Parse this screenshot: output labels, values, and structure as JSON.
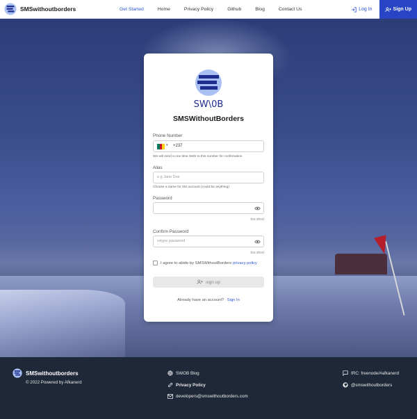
{
  "nav": {
    "brand": "SMSwithoutborders",
    "links": [
      "Get Started",
      "Home",
      "Privacy Policy",
      "Github",
      "Blog",
      "Contact Us"
    ],
    "active_index": 0,
    "login": "Log In",
    "signup": "Sign Up"
  },
  "card": {
    "logo_text": "SW\\0B",
    "title": "SMSWithoutBorders",
    "phone": {
      "label": "Phone Number",
      "dial_code": "+237",
      "helper": "We will send a one time SMS to this number for confirmation"
    },
    "alias": {
      "label": "Alias",
      "placeholder": "e.g Jane Doe",
      "helper": "Choose a name for this account (could be anything)"
    },
    "password": {
      "label": "Password",
      "placeholder": "",
      "strength": "too short"
    },
    "confirm_password": {
      "label": "Confirm Password",
      "placeholder": "retype password",
      "strength": "too short"
    },
    "terms": {
      "text": "I agree to abide by SMSWithoutBorders",
      "link": "privacy policy",
      "checked": false
    },
    "submit": "sign up",
    "login_prompt": "Already have an account?",
    "login_link": "Sign In"
  },
  "footer": {
    "brand": "SMSwithoutborders",
    "copyright": "© 2022 Powered by Afkanerd",
    "links_mid": [
      "SWOB Blog",
      "Privacy Policy",
      "developers@smswithoutborders.com"
    ],
    "links_right": [
      "IRC: freenode/#afkanerd",
      "@smswithoutborders"
    ]
  },
  "colors": {
    "accent": "#2b54d6",
    "signup_bg": "#2745c4",
    "footer_bg": "#1f2838",
    "logo_circle": "#a9c1f2",
    "logo_navy": "#1f2c8f"
  },
  "icons": {
    "brand": "swob-logo",
    "login": "login-icon",
    "signup": "add-user-icon",
    "eye": "eye-icon",
    "footer_blog": "globe-icon",
    "footer_privacy": "link-icon",
    "footer_email": "mail-icon",
    "footer_irc": "chat-icon",
    "footer_github": "github-icon"
  }
}
